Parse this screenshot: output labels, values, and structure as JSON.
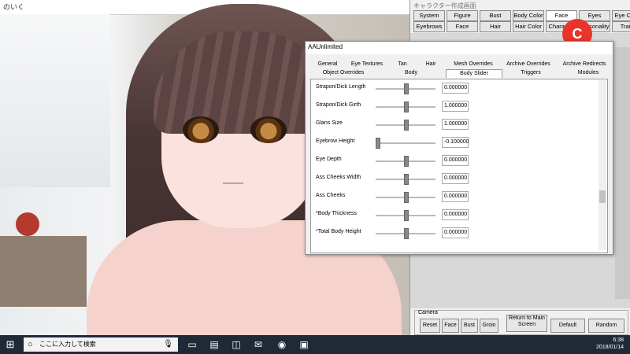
{
  "background_window": {
    "title": "のいく"
  },
  "char_panel": {
    "title": "キャラクター作成画面",
    "row1": [
      "System",
      "Figure",
      "Bust",
      "Body Color",
      "Face",
      "Eyes",
      "Eye Color"
    ],
    "row2": [
      "Eyebrows",
      "Face Details",
      "Hair",
      "Hair Color",
      "Character",
      "Personality",
      "Traits"
    ],
    "logo_text": "C"
  },
  "dialog": {
    "title": "AAUnlimited",
    "tabs_row1": [
      "General",
      "Eye Textures",
      "Tan",
      "Hair",
      "Mesh Overrides",
      "Archive Overrides",
      "Archive Redirects"
    ],
    "tabs_row2": [
      "Object Overrides",
      "Body",
      "Body Slider",
      "Triggers",
      "Modules"
    ],
    "active_tab": "Body Slider",
    "sliders": [
      {
        "label": "Strapon/Dick Length",
        "value": "0.000000",
        "level": 0.5
      },
      {
        "label": "Strapon/Dick Girth",
        "value": "1.000000",
        "level": 0.5
      },
      {
        "label": "Glans Size",
        "value": "1.000000",
        "level": 0.5
      },
      {
        "label": "Eyebrow Height",
        "value": "-0.100000",
        "level": 0.0
      },
      {
        "label": "Eye Depth",
        "value": "0.000000",
        "level": 0.5
      },
      {
        "label": "Ass Cheeks Width",
        "value": "0.000000",
        "level": 0.5
      },
      {
        "label": "Ass Cheeks",
        "value": "0.000000",
        "level": 0.5
      },
      {
        "label": "*Body Thickness",
        "value": "0.000000",
        "level": 0.5
      },
      {
        "label": "*Total Body Height",
        "value": "0.000000",
        "level": 0.5
      }
    ]
  },
  "camera": {
    "label": "Camera",
    "buttons": [
      "Reset",
      "Face",
      "Bust",
      "Groin"
    ],
    "return_button": "Return to Main Screen",
    "default_button": "Default",
    "random_button": "Random"
  },
  "taskbar": {
    "search_placeholder": "ここに入力して検索",
    "time": "6:38",
    "date": "2018/01/14"
  }
}
